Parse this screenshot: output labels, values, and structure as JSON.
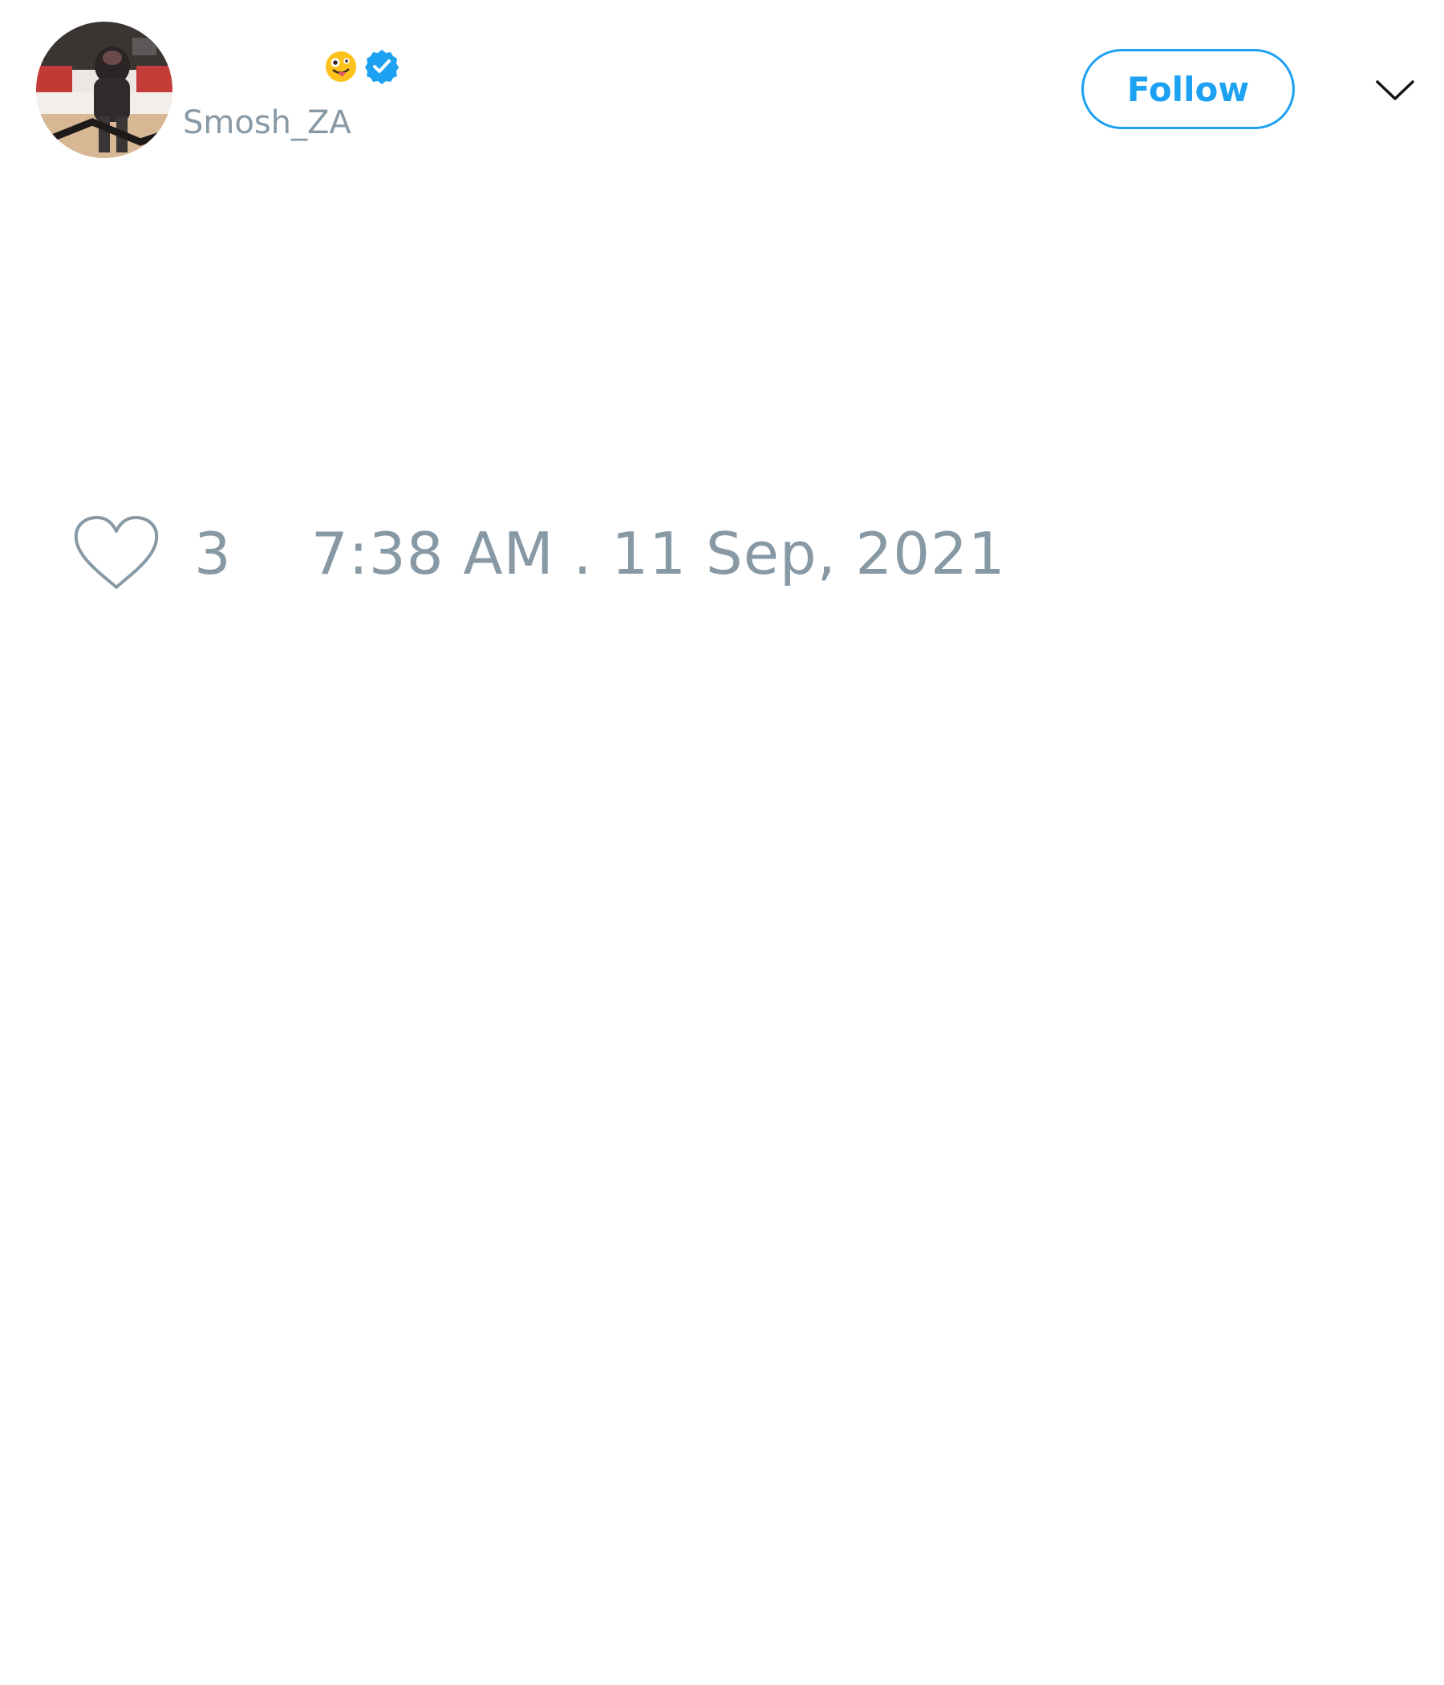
{
  "tweet": {
    "author": {
      "display_name": "",
      "handle": "Smosh_ZA",
      "name_emoji_icon": "zany-face-emoji",
      "verified_icon": "verified-badge-icon",
      "verified_color": "#1da1f2",
      "avatar": "profile-photo"
    },
    "follow_label": "Follow",
    "more_icon": "chevron-down-icon",
    "like_icon": "heart-outline-icon",
    "like_count": "3",
    "timestamp": "7:38 AM . 11 Sep, 2021"
  },
  "colors": {
    "accent": "#1da1f2",
    "muted_text": "#8899a6",
    "background": "#ffffff"
  }
}
